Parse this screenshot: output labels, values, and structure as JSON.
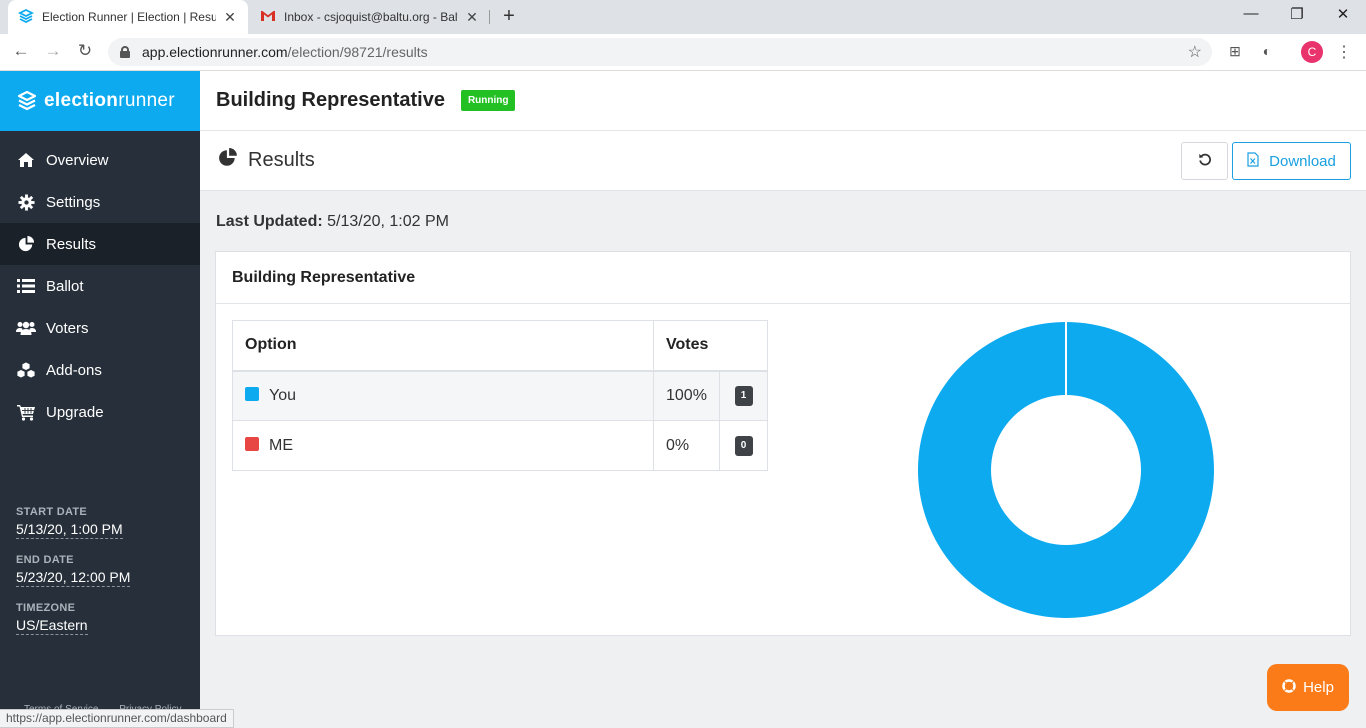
{
  "browser": {
    "tabs": [
      {
        "title": "Election Runner | Election | Results"
      },
      {
        "title": "Inbox - csjoquist@baltu.org - Baltu"
      }
    ],
    "url_host": "app.electionrunner.com",
    "url_path": "/election/98721/results",
    "profile_initial": "C",
    "status_url": "https://app.electionrunner.com/dashboard"
  },
  "brand": {
    "name_bold": "election",
    "name_light": "runner"
  },
  "sidebar": {
    "items": [
      {
        "label": "Overview",
        "icon": "home-icon"
      },
      {
        "label": "Settings",
        "icon": "gear-icon"
      },
      {
        "label": "Results",
        "icon": "pie-chart-icon"
      },
      {
        "label": "Ballot",
        "icon": "list-icon"
      },
      {
        "label": "Voters",
        "icon": "users-icon"
      },
      {
        "label": "Add-ons",
        "icon": "cubes-icon"
      },
      {
        "label": "Upgrade",
        "icon": "cart-icon"
      }
    ],
    "active_index": 2,
    "start_label": "START DATE",
    "start_value": "5/13/20, 1:00 PM",
    "end_label": "END DATE",
    "end_value": "5/23/20, 12:00 PM",
    "tz_label": "TIMEZONE",
    "tz_value": "US/Eastern",
    "footer_terms": "Terms of Service",
    "footer_privacy": "Privacy Policy"
  },
  "header": {
    "election_title": "Building Representative",
    "status": "Running"
  },
  "results": {
    "title": "Results",
    "download_label": "Download",
    "last_updated_label": "Last Updated:",
    "last_updated_value": "5/13/20, 1:02 PM",
    "card_title": "Building Representative",
    "col_option": "Option",
    "col_votes": "Votes",
    "rows": [
      {
        "option": "You",
        "pct": "100%",
        "count": "1",
        "color": "#0daaf0"
      },
      {
        "option": "ME",
        "pct": "0%",
        "count": "0",
        "color": "#e84545"
      }
    ]
  },
  "chart_data": {
    "type": "pie",
    "categories": [
      "You",
      "ME"
    ],
    "values": [
      1,
      0
    ],
    "colors": [
      "#0daaf0",
      "#e84545"
    ]
  },
  "help": {
    "label": "Help"
  }
}
